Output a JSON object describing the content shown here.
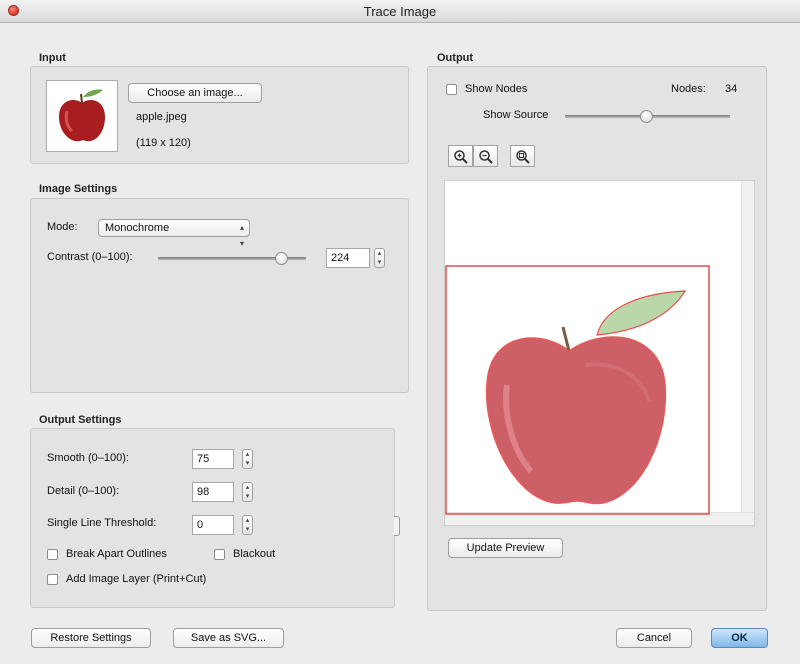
{
  "window": {
    "title": "Trace Image"
  },
  "input": {
    "section_label": "Input",
    "choose_button": "Choose an image...",
    "file_name": "apple.jpeg",
    "dimensions": "(119 x 120)"
  },
  "image_settings": {
    "section_label": "Image Settings",
    "mode_label": "Mode:",
    "mode_value": "Monochrome",
    "contrast_label": "Contrast (0–100):",
    "contrast_value": "224"
  },
  "output_settings": {
    "section_label": "Output Settings",
    "smooth_label": "Smooth (0–100):",
    "smooth_value": "75",
    "detail_label": "Detail (0–100):",
    "detail_value": "98",
    "threshold_label": "Single Line Threshold:",
    "threshold_value": "0",
    "break_apart_label": "Break Apart Outlines",
    "blackout_label": "Blackout",
    "add_layer_label": "Add Image Layer (Print+Cut)"
  },
  "output": {
    "section_label": "Output",
    "show_nodes_label": "Show Nodes",
    "nodes_label": "Nodes:",
    "nodes_value": "34",
    "show_source_label": "Show Source",
    "update_preview_button": "Update Preview",
    "icons": [
      "zoom-in-icon",
      "zoom-out-icon",
      "zoom-fit-icon"
    ]
  },
  "footer": {
    "restore_button": "Restore Settings",
    "save_svg_button": "Save as SVG...",
    "cancel_button": "Cancel",
    "ok_button": "OK"
  },
  "colors": {
    "trace_outline": "#e84a4a",
    "accent": "#7fb7ea"
  }
}
